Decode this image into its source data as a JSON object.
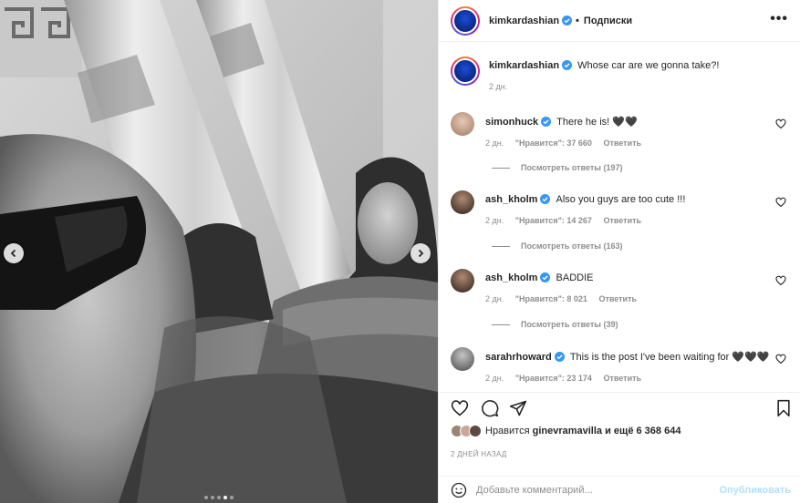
{
  "post": {
    "author": "kimkardashian",
    "separator": "•",
    "follow_label": "Подписки",
    "more_label": "•••",
    "caption_text": "Whose car are we gonna take?!",
    "caption_time": "2 дн."
  },
  "comments": [
    {
      "username": "simonhuck",
      "text": "There he is! 🖤🖤",
      "time": "2 дн.",
      "likes": "\"Нравится\": 37 660",
      "reply": "Ответить",
      "view_replies": "Посмотреть ответы (197)"
    },
    {
      "username": "ash_kholm",
      "text": "Also you guys are too cute !!!",
      "time": "2 дн.",
      "likes": "\"Нравится\": 14 267",
      "reply": "Ответить",
      "view_replies": "Посмотреть ответы (163)"
    },
    {
      "username": "ash_kholm",
      "text": "BADDIE",
      "time": "2 дн.",
      "likes": "\"Нравится\": 8 021",
      "reply": "Ответить",
      "view_replies": "Посмотреть ответы (39)"
    },
    {
      "username": "sarahrhoward",
      "text": "This is the post I've been waiting for 🖤🖤🖤",
      "time": "2 дн.",
      "likes": "\"Нравится\": 23 174",
      "reply": "Ответить"
    }
  ],
  "likes_summary": {
    "prefix": "Нравится",
    "user": "ginevramavilla",
    "suffix": "и ещё 6 368 644"
  },
  "posted_ago": "2 ДНЕЙ НАЗАД",
  "comment_box": {
    "placeholder": "Добавьте комментарий...",
    "publish_label": "Опубликовать"
  },
  "carousel": {
    "total": 5,
    "active_index": 3
  },
  "colors": {
    "verified": "#3897f0",
    "publish": "#b2dffc",
    "muted": "#8e8e8e"
  }
}
